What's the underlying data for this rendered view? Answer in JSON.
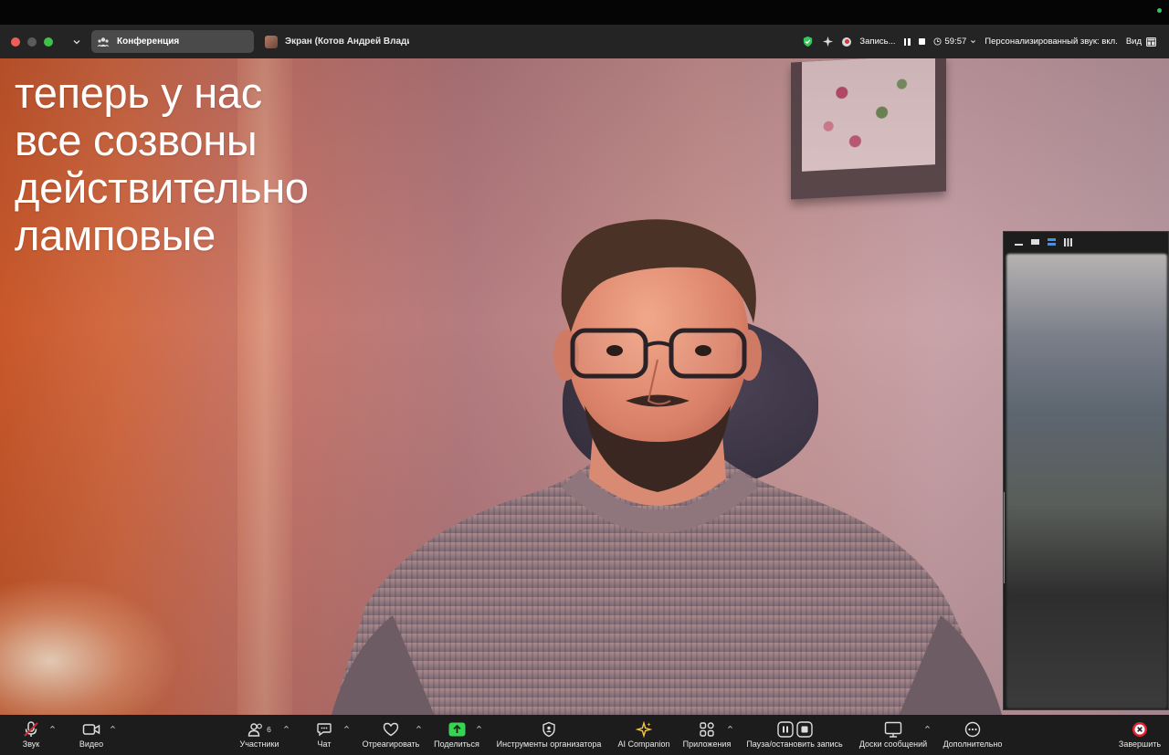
{
  "window": {
    "active_tab": "Конференция",
    "other_tab": "Экран (Котов Андрей Владимир"
  },
  "status": {
    "recording": "Запись...",
    "timer": "59:57",
    "personal_sound": "Персонализированный звук: вкл.",
    "view": "Вид"
  },
  "video": {
    "caption_lines": [
      "теперь у нас",
      "все созвоны",
      "действительно",
      "ламповые"
    ]
  },
  "toolbar": {
    "audio": "Звук",
    "video": "Видео",
    "participants": "Участники",
    "participants_count": "6",
    "chat": "Чат",
    "react": "Отреагировать",
    "share": "Поделиться",
    "host_tools": "Инструменты организатора",
    "ai_companion": "AI Companion",
    "apps": "Приложения",
    "pause_stop_recording": "Пауза/остановить запись",
    "whiteboards": "Доски сообщений",
    "more": "Дополнительно",
    "end": "Завершить"
  },
  "colors": {
    "window_bg": "#242424",
    "toolbar_bg": "#1c1c1c",
    "share_green": "#39d353",
    "end_red": "#e0242f",
    "mute_red": "#e0242f",
    "secure_green": "#34c759"
  },
  "icons": [
    "chevron-down-icon",
    "participants-icon",
    "mic-muted-icon",
    "camera-icon",
    "chat-icon",
    "heart-icon",
    "share-arrow-icon",
    "shield-icon",
    "sparkle-icon",
    "apps-icon",
    "pause-icon",
    "stop-icon",
    "whiteboard-icon",
    "more-icon",
    "close-icon",
    "clock-icon"
  ]
}
